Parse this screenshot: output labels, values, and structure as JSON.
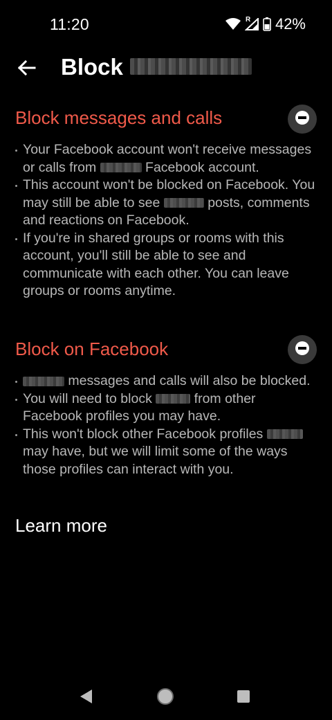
{
  "status_bar": {
    "time": "11:20",
    "roaming_marker": "R",
    "battery_percent": "42%"
  },
  "header": {
    "title": "Block",
    "back_icon": "arrow-left-icon"
  },
  "sections": [
    {
      "heading": "Block messages and calls",
      "toggle_icon": "minus-circle-icon",
      "bullets": [
        {
          "before": "Your Facebook account won't receive messages or calls from",
          "after": "Facebook account."
        },
        {
          "before": "This account won't be blocked on Facebook. You may still be able to see",
          "after": "posts, comments and reactions on Facebook."
        },
        {
          "before": "If you're in shared groups or rooms with this account, you'll still be able to see and communicate with each other. You can leave groups or rooms anytime.",
          "after": ""
        }
      ]
    },
    {
      "heading": "Block on Facebook",
      "toggle_icon": "minus-circle-icon",
      "bullets": [
        {
          "before": "",
          "after": "messages and calls will also be blocked."
        },
        {
          "before": "You will need to block",
          "after": "from other Facebook profiles you may have."
        },
        {
          "before": "This won't block other Facebook profiles",
          "after": "may have, but we will limit some of the ways those profiles can interact with you."
        }
      ]
    }
  ],
  "learn_more": "Learn more",
  "nav": {
    "back_icon": "nav-back-triangle-icon",
    "home_icon": "nav-home-circle-icon",
    "recents_icon": "nav-recents-square-icon"
  },
  "colors": {
    "background": "#000000",
    "heading_red": "#f05a4a",
    "body_text": "#b8b8b8",
    "toggle_bg": "#3a3a3a"
  }
}
